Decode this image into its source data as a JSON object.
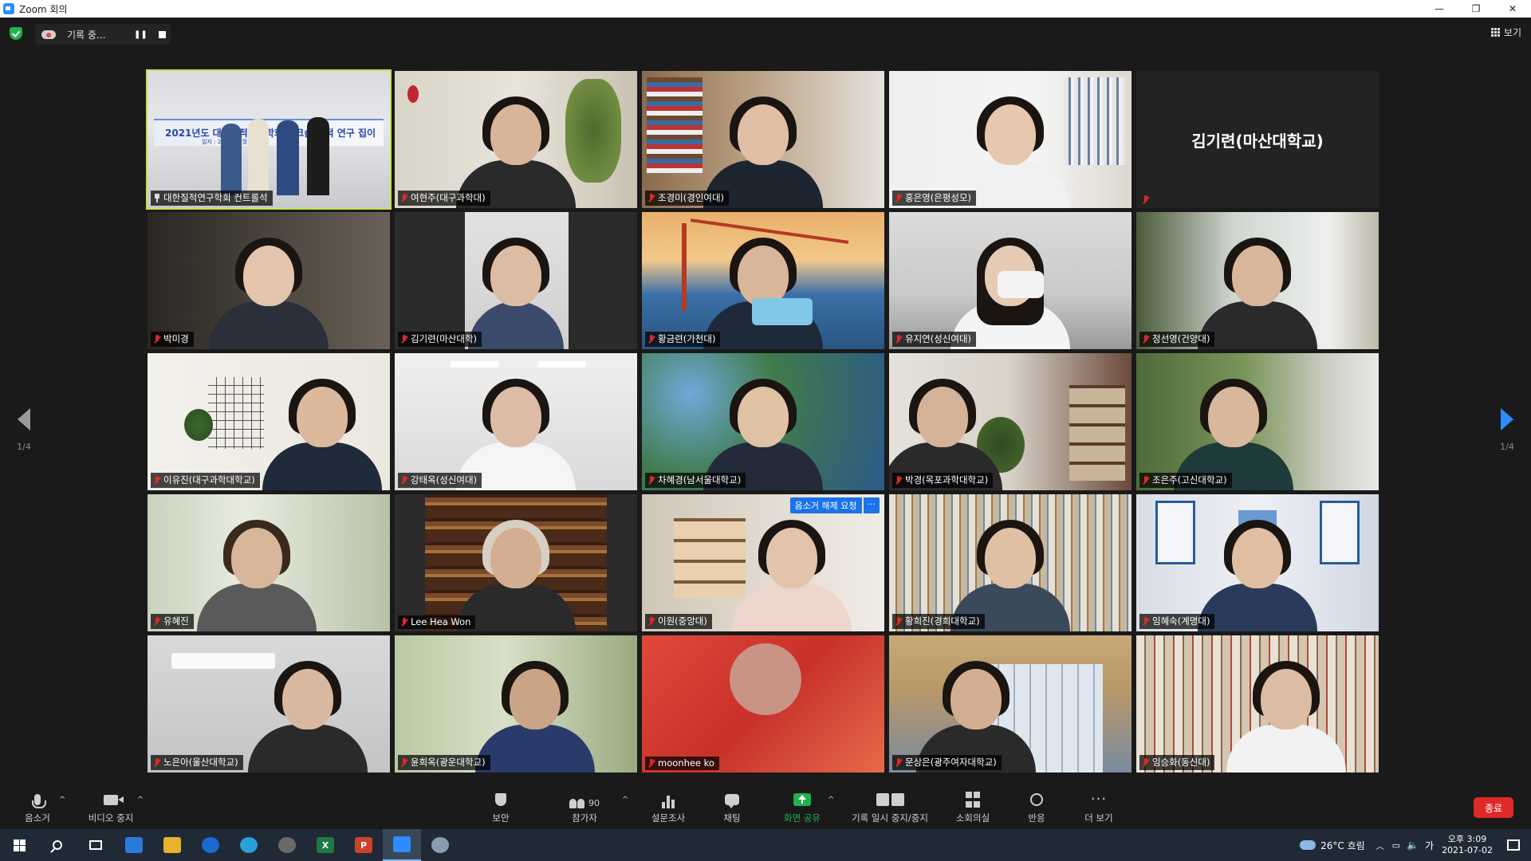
{
  "window": {
    "title": "Zoom 회의",
    "controls": [
      "—",
      "❐",
      "✕"
    ]
  },
  "recording": {
    "label": "기록 중...",
    "pause": "❚❚"
  },
  "view": {
    "label": "보기"
  },
  "pager": {
    "left": "1/4",
    "right": "1/4"
  },
  "banner": {
    "title": "2021년도 대한질적연구학회 워크숍 질적 연구 집이",
    "sub": "일자 : 2021년 7월"
  },
  "tiles": [
    {
      "name": "대한질적연구학회 컨트롤석",
      "pinned": true
    },
    {
      "name": "여현주(대구과학대)"
    },
    {
      "name": "조경미(경인여대)"
    },
    {
      "name": "홍은영(은평성모)"
    },
    {
      "name": "",
      "display": "김기련(마산대학교)"
    },
    {
      "name": "박미경"
    },
    {
      "name": "김기련(마산대학)"
    },
    {
      "name": "황금련(가천대)"
    },
    {
      "name": "유지연(성신여대)"
    },
    {
      "name": "정선영(건양대)"
    },
    {
      "name": "이유진(대구과학대학교)"
    },
    {
      "name": "강태옥(성신여대)"
    },
    {
      "name": "차혜경(남서울대학교)"
    },
    {
      "name": "박경(목포과학대학교)"
    },
    {
      "name": "조은주(고신대학교)"
    },
    {
      "name": "유혜진"
    },
    {
      "name": "Lee Hea Won"
    },
    {
      "name": "이원(중앙대)",
      "request": "음소거 해제 요청",
      "request_more": "···"
    },
    {
      "name": "황희진(경희대학교)"
    },
    {
      "name": "임혜숙(계명대)"
    },
    {
      "name": "노은아(울산대학교)"
    },
    {
      "name": "윤희옥(광운대학교)"
    },
    {
      "name": "moonhee ko"
    },
    {
      "name": "문상은(광주여자대학교)"
    },
    {
      "name": "임승화(동신대)"
    }
  ],
  "toolbar": {
    "mute": "음소거",
    "video": "비디오 중지",
    "security": "보안",
    "participants": "참가자",
    "participant_count": "90",
    "polls": "설문조사",
    "chat": "채팅",
    "share": "화면 공유",
    "record": "기록 일시 중지/중지",
    "breakout": "소회의실",
    "reactions": "반응",
    "more": "더 보기",
    "end": "종료",
    "caret": "^"
  },
  "taskbar": {
    "weather": "26°C 흐림",
    "ime": "가",
    "time": "오후 3:09",
    "date": "2021-07-02",
    "excel": "X",
    "ppt": "P"
  }
}
